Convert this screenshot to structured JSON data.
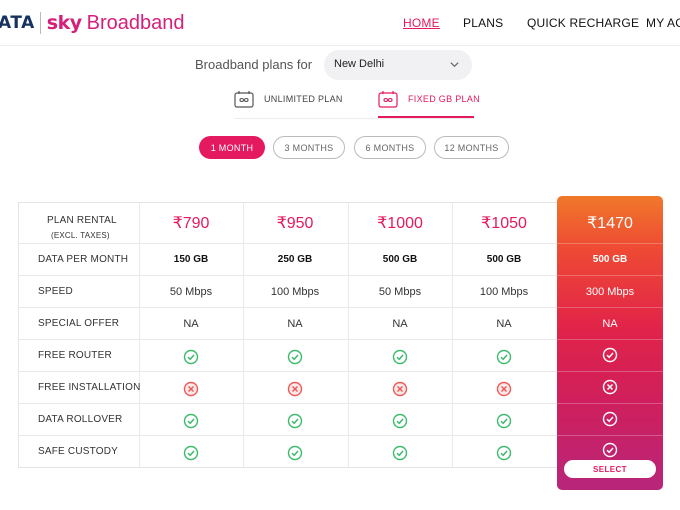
{
  "header": {
    "logo": {
      "brand": "ATA",
      "sky": "sky",
      "product": "Broadband"
    },
    "nav": {
      "home": "HOME",
      "plans": "PLANS",
      "quick_recharge": "QUICK RECHARGE",
      "my_account": "MY ACC"
    }
  },
  "location": {
    "label": "Broadband plans for",
    "selected": "New Delhi"
  },
  "plan_types": [
    {
      "label": "UNLIMITED PLAN",
      "active": false,
      "icon": "infinity-router-icon"
    },
    {
      "label": "FIXED GB PLAN",
      "active": true,
      "icon": "gb-router-icon"
    }
  ],
  "durations": [
    "1 MONTH",
    "3 MONTHS",
    "6 MONTHS",
    "12 MONTHS"
  ],
  "table": {
    "row_labels": [
      "PLAN RENTAL",
      "(EXCL. TAXES)",
      "DATA PER MONTH",
      "SPEED",
      "SPECIAL OFFER",
      "FREE ROUTER",
      "FREE INSTALLATION",
      "DATA ROLLOVER",
      "SAFE CUSTODY"
    ],
    "plans": [
      {
        "price": "₹790",
        "data": "150 GB",
        "speed": "50 Mbps",
        "offer": "NA",
        "router": true,
        "installation": false,
        "rollover": true,
        "custody": true
      },
      {
        "price": "₹950",
        "data": "250 GB",
        "speed": "100 Mbps",
        "offer": "NA",
        "router": true,
        "installation": false,
        "rollover": true,
        "custody": true
      },
      {
        "price": "₹1000",
        "data": "500 GB",
        "speed": "50 Mbps",
        "offer": "NA",
        "router": true,
        "installation": false,
        "rollover": true,
        "custody": true
      },
      {
        "price": "₹1050",
        "data": "500 GB",
        "speed": "100 Mbps",
        "offer": "NA",
        "router": true,
        "installation": false,
        "rollover": true,
        "custody": true
      }
    ],
    "featured": {
      "price": "₹1470",
      "data": "500 GB",
      "speed": "300 Mbps",
      "offer": "NA",
      "router": true,
      "installation": false,
      "rollover": true,
      "custody": true,
      "select_label": "SELECT"
    }
  },
  "colors": {
    "accent": "#e5195f",
    "check": "#3dbb6b",
    "cross": "#ef5a5a",
    "navy": "#17325e"
  }
}
